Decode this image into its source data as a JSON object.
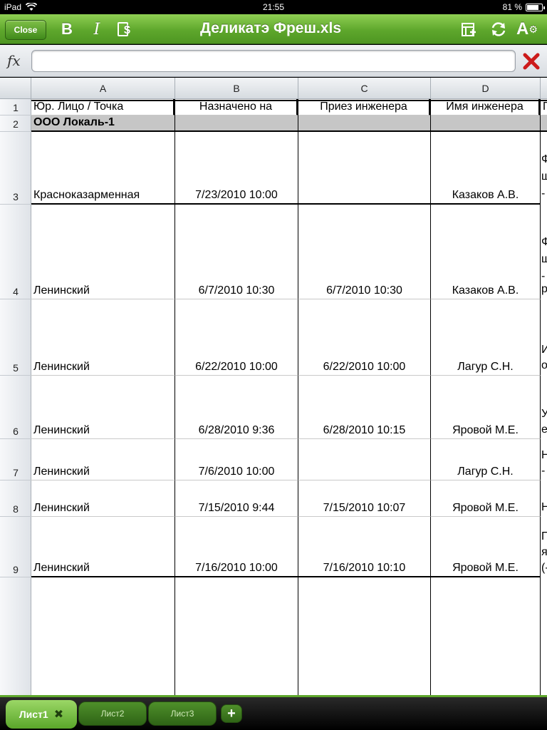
{
  "status_bar": {
    "device": "iPad",
    "time": "21:55",
    "battery": "81 %",
    "battery_level": 0.81
  },
  "toolbar": {
    "close_label": "Close",
    "title": "Деликатэ Фреш.xls",
    "bold_icon": "bold-icon",
    "italic_icon": "italic-icon",
    "currency_icon": "currency-format-icon",
    "insert_icon": "insert-icon",
    "refresh_icon": "refresh-icon",
    "format_icon": "format-icon"
  },
  "formula_bar": {
    "fx_label": "fx",
    "value": "",
    "cancel_icon": "cancel-x-icon"
  },
  "columns": [
    "A",
    "B",
    "C",
    "D"
  ],
  "headers": {
    "a": "Юр. Лицо / Точка",
    "b": "Назначено на",
    "c": "Приез инженера",
    "d": "Имя инженера",
    "e": "П"
  },
  "group_row": {
    "label": "ООО Локаль-1"
  },
  "rows": [
    {
      "num": "1"
    },
    {
      "num": "2"
    },
    {
      "num": "3",
      "a": "Красноказарменная",
      "b": "7/23/2010 10:00",
      "c": "",
      "d": "Казаков А.В.",
      "e": [
        "Ф",
        "ш",
        "-"
      ]
    },
    {
      "num": "4",
      "a": "Ленинский",
      "b": "6/7/2010 10:30",
      "c": "6/7/2010 10:30",
      "d": "Казаков А.В.",
      "e": [
        "Ф",
        "ш",
        "-",
        "р"
      ]
    },
    {
      "num": "5",
      "a": "Ленинский",
      "b": "6/22/2010 10:00",
      "c": "6/22/2010 10:00",
      "d": "Лагур  С.Н.",
      "e": [
        "И",
        "о"
      ]
    },
    {
      "num": "6",
      "a": "Ленинский",
      "b": "6/28/2010 9:36",
      "c": "6/28/2010 10:15",
      "d": "Яровой М.Е.",
      "e": [
        "У",
        "е"
      ]
    },
    {
      "num": "7",
      "a": "Ленинский",
      "b": "7/6/2010 10:00",
      "c": "",
      "d": "Лагур  С.Н.",
      "e": [
        "Н",
        "-"
      ]
    },
    {
      "num": "8",
      "a": "Ленинский",
      "b": "7/15/2010 9:44",
      "c": "7/15/2010 10:07",
      "d": "Яровой М.Е.",
      "e": [
        "Н"
      ]
    },
    {
      "num": "9",
      "a": "Ленинский",
      "b": "7/16/2010 10:00",
      "c": "7/16/2010 10:10",
      "d": "Яровой М.Е.",
      "e": [
        "П",
        "я",
        "(-"
      ]
    }
  ],
  "sheets": [
    {
      "label": "Лист1",
      "active": true
    },
    {
      "label": "Лист2",
      "active": false
    },
    {
      "label": "Лист3",
      "active": false
    }
  ],
  "add_sheet_label": "+",
  "colors": {
    "toolbar_green": "#5ea72c",
    "cancel_red": "#cc1b1b"
  }
}
